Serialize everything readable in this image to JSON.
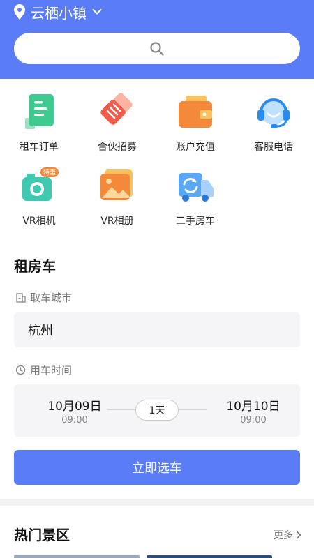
{
  "header": {
    "location": "云栖小镇",
    "bg_color": "#5b7cf7"
  },
  "services": [
    {
      "label": "租车订单",
      "icon": "order-document-icon"
    },
    {
      "label": "合伙招募",
      "icon": "partner-recruit-icon"
    },
    {
      "label": "账户充值",
      "icon": "wallet-icon"
    },
    {
      "label": "客服电话",
      "icon": "headset-icon"
    },
    {
      "label": "VR相机",
      "icon": "camera-icon",
      "badge": "特惠"
    },
    {
      "label": "VR相册",
      "icon": "photo-album-icon"
    },
    {
      "label": "二手房车",
      "icon": "used-rv-icon"
    }
  ],
  "rent": {
    "title": "租房车",
    "city_label": "取车城市",
    "city_value": "杭州",
    "time_label": "用车时间",
    "start_date": "10月09日",
    "start_time": "09:00",
    "duration": "1天",
    "end_date": "10月10日",
    "end_time": "09:00",
    "submit_label": "立即选车"
  },
  "hot": {
    "title": "热门景区",
    "more_label": "更多"
  },
  "colors": {
    "accent": "#5b7cf7",
    "field_bg": "#f5f5f7"
  }
}
